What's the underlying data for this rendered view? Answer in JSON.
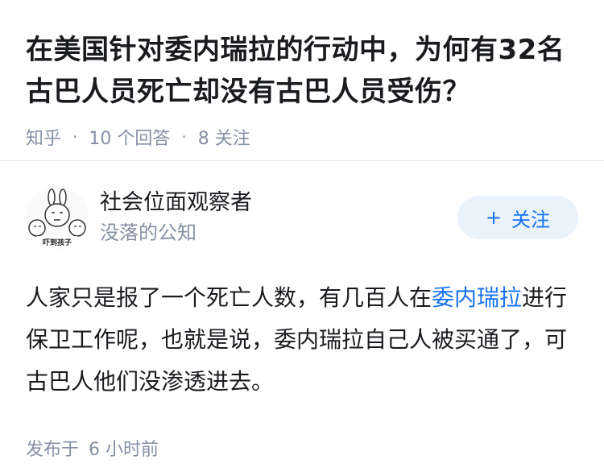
{
  "question": {
    "title": "在美国针对委内瑞拉的行动中，为何有32名古巴人员死亡却没有古巴人员受伤？",
    "source": "知乎",
    "answers_count": "10 个回答",
    "followers_count": "8 关注"
  },
  "answer": {
    "author": {
      "name": "社会位面观察者",
      "bio": "没落的公知",
      "avatar_caption": "吓到孩子"
    },
    "follow_button": {
      "plus": "+",
      "label": "关注"
    },
    "content": {
      "part1": "人家只是报了一个死亡人数，有几百人在",
      "link": "委内瑞拉",
      "part2": "进行保卫工作呢，也就是说，委内瑞拉自己人被买通了，可古巴人他们没渗透进去。"
    },
    "posted_prefix": "发布于",
    "posted_time": "6 小时前"
  },
  "colors": {
    "link": "#1772f6",
    "muted": "#8590a6",
    "button_bg": "#eaf2fc"
  }
}
